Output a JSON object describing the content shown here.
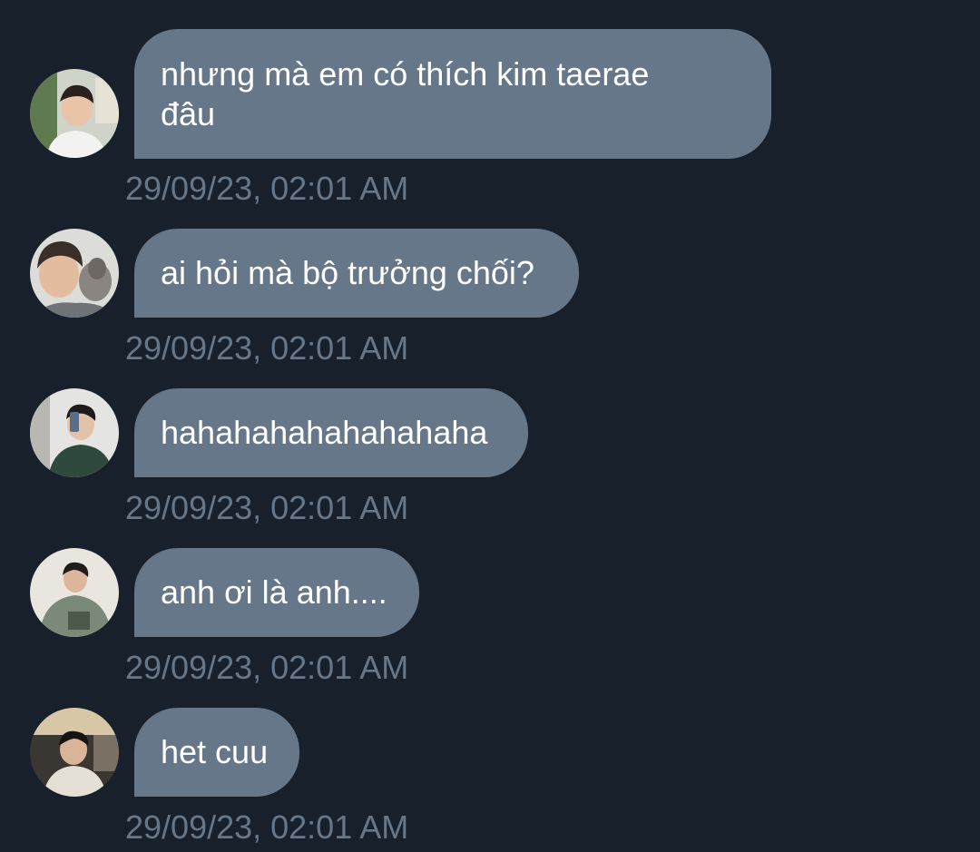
{
  "messages": [
    {
      "text": "nhưng mà em có thích kim taerae\nđâu",
      "time": "29/09/23, 02:01 AM"
    },
    {
      "text": "ai hỏi mà bộ trưởng chối?",
      "time": "29/09/23, 02:01 AM"
    },
    {
      "text": "hahahahahahahahaha",
      "time": "29/09/23, 02:01 AM"
    },
    {
      "text": "anh ơi là anh....",
      "time": "29/09/23, 02:01 AM"
    },
    {
      "text": "het cuu",
      "time": "29/09/23, 02:01 AM"
    }
  ]
}
